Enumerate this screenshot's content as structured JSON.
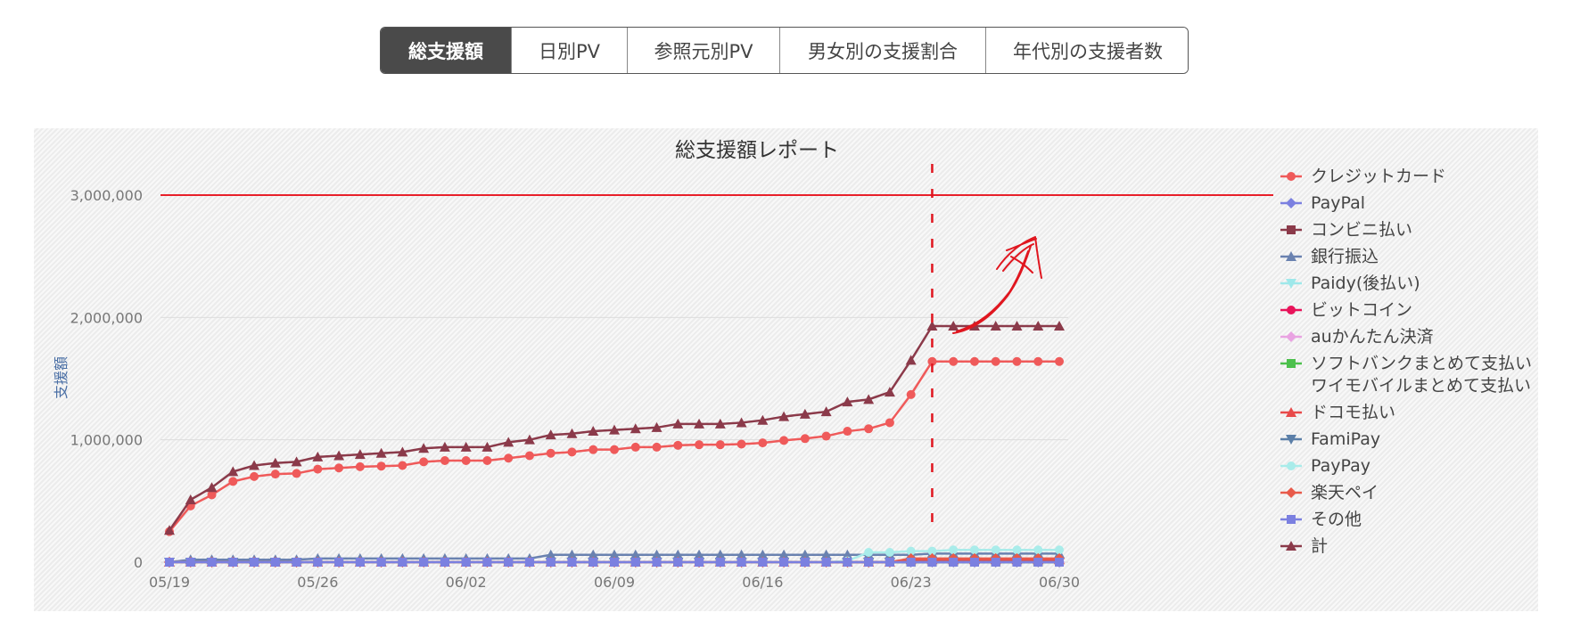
{
  "tabs": [
    {
      "label": "総支援額",
      "active": true
    },
    {
      "label": "日別PV",
      "active": false
    },
    {
      "label": "参照元別PV",
      "active": false
    },
    {
      "label": "男女別の支援割合",
      "active": false
    },
    {
      "label": "年代別の支援者数",
      "active": false
    }
  ],
  "colors": {
    "accent_line": "#e8202a",
    "annotation": "#e0161f",
    "tab_active_bg": "#4a4a4a"
  },
  "chart_data": {
    "type": "line",
    "title": "総支援額レポート",
    "xlabel": "",
    "ylabel": "支援額",
    "ylim": [
      0,
      3000000
    ],
    "y_ticks": [
      0,
      1000000,
      2000000,
      3000000
    ],
    "y_tick_labels": [
      "0",
      "1,000,000",
      "2,000,000",
      "3,000,000"
    ],
    "x_tick_labels": [
      "05/19",
      "05/26",
      "06/02",
      "06/09",
      "06/16",
      "06/23",
      "06/30"
    ],
    "x": [
      "05/19",
      "05/20",
      "05/21",
      "05/22",
      "05/23",
      "05/24",
      "05/25",
      "05/26",
      "05/27",
      "05/28",
      "05/29",
      "05/30",
      "05/31",
      "06/01",
      "06/02",
      "06/03",
      "06/04",
      "06/05",
      "06/06",
      "06/07",
      "06/08",
      "06/09",
      "06/10",
      "06/11",
      "06/12",
      "06/13",
      "06/14",
      "06/15",
      "06/16",
      "06/17",
      "06/18",
      "06/19",
      "06/20",
      "06/21",
      "06/22",
      "06/23",
      "06/24",
      "06/25",
      "06/26",
      "06/27",
      "06/28",
      "06/29",
      "06/30"
    ],
    "goal_line": 3000000,
    "marker_date": "06/24",
    "legend_position": "right",
    "grid": true,
    "series": [
      {
        "name": "クレジットカード",
        "color": "#ef5a5a",
        "marker": "circle",
        "values": [
          250000,
          460000,
          550000,
          660000,
          700000,
          720000,
          725000,
          760000,
          770000,
          780000,
          785000,
          790000,
          820000,
          830000,
          830000,
          830000,
          850000,
          870000,
          890000,
          900000,
          920000,
          920000,
          940000,
          940000,
          955000,
          960000,
          960000,
          965000,
          975000,
          995000,
          1010000,
          1030000,
          1070000,
          1090000,
          1140000,
          1370000,
          1640000,
          1640000,
          1640000,
          1640000,
          1640000,
          1640000,
          1640000
        ]
      },
      {
        "name": "PayPal",
        "color": "#7b80e0",
        "marker": "diamond",
        "values": [
          0,
          0,
          0,
          0,
          0,
          0,
          0,
          0,
          0,
          0,
          0,
          0,
          0,
          0,
          0,
          0,
          0,
          0,
          0,
          0,
          0,
          0,
          0,
          0,
          0,
          0,
          0,
          0,
          0,
          0,
          0,
          0,
          0,
          0,
          0,
          0,
          0,
          0,
          0,
          0,
          0,
          0,
          0
        ]
      },
      {
        "name": "コンビニ払い",
        "color": "#8b3a4a",
        "marker": "square",
        "values": [
          0,
          0,
          0,
          0,
          0,
          0,
          0,
          0,
          0,
          0,
          0,
          0,
          0,
          0,
          0,
          0,
          0,
          0,
          0,
          0,
          0,
          0,
          0,
          0,
          0,
          0,
          0,
          0,
          0,
          0,
          0,
          0,
          0,
          0,
          0,
          0,
          0,
          0,
          0,
          0,
          0,
          0,
          0
        ]
      },
      {
        "name": "銀行振込",
        "color": "#6a82b0",
        "marker": "triangle",
        "values": [
          0,
          20000,
          20000,
          20000,
          20000,
          20000,
          20000,
          30000,
          30000,
          30000,
          30000,
          30000,
          30000,
          30000,
          30000,
          30000,
          30000,
          30000,
          60000,
          60000,
          60000,
          60000,
          60000,
          60000,
          60000,
          60000,
          60000,
          60000,
          60000,
          60000,
          60000,
          60000,
          60000,
          60000,
          60000,
          60000,
          70000,
          70000,
          70000,
          70000,
          70000,
          70000,
          70000
        ]
      },
      {
        "name": "Paidy(後払い)",
        "color": "#9ee8ea",
        "marker": "triangle-down",
        "values": [
          0,
          0,
          0,
          0,
          0,
          0,
          0,
          0,
          0,
          0,
          0,
          0,
          0,
          0,
          0,
          0,
          0,
          0,
          0,
          0,
          0,
          0,
          0,
          0,
          0,
          0,
          0,
          0,
          0,
          0,
          0,
          0,
          0,
          0,
          0,
          0,
          0,
          0,
          0,
          0,
          0,
          0,
          0
        ]
      },
      {
        "name": "ビットコイン",
        "color": "#e8135a",
        "marker": "circle",
        "values": [
          0,
          0,
          0,
          0,
          0,
          0,
          0,
          0,
          0,
          0,
          0,
          0,
          0,
          0,
          0,
          0,
          0,
          0,
          0,
          0,
          0,
          0,
          0,
          0,
          0,
          0,
          0,
          0,
          0,
          0,
          0,
          0,
          0,
          0,
          0,
          0,
          0,
          0,
          0,
          0,
          0,
          0,
          0
        ]
      },
      {
        "name": "auかんたん決済",
        "color": "#e9a3e2",
        "marker": "diamond",
        "values": [
          0,
          0,
          0,
          0,
          0,
          0,
          0,
          0,
          0,
          0,
          0,
          0,
          0,
          0,
          0,
          0,
          0,
          0,
          0,
          0,
          0,
          0,
          0,
          0,
          0,
          0,
          0,
          0,
          0,
          0,
          0,
          0,
          0,
          0,
          0,
          0,
          0,
          0,
          0,
          0,
          0,
          0,
          0
        ]
      },
      {
        "name": "ソフトバンクまとめて支払い・",
        "name2": "ワイモバイルまとめて支払い",
        "color": "#4cc04c",
        "marker": "square",
        "values": [
          0,
          0,
          0,
          0,
          0,
          0,
          0,
          0,
          0,
          0,
          0,
          0,
          0,
          0,
          0,
          0,
          0,
          0,
          0,
          0,
          0,
          0,
          0,
          0,
          0,
          0,
          0,
          0,
          0,
          0,
          0,
          0,
          0,
          0,
          0,
          0,
          0,
          0,
          0,
          0,
          0,
          0,
          0
        ]
      },
      {
        "name": "ドコモ払い",
        "color": "#e84a4a",
        "marker": "triangle",
        "values": [
          0,
          0,
          0,
          0,
          0,
          0,
          0,
          0,
          0,
          0,
          0,
          0,
          0,
          0,
          0,
          0,
          0,
          0,
          0,
          0,
          0,
          0,
          0,
          0,
          0,
          0,
          0,
          0,
          0,
          0,
          0,
          0,
          0,
          0,
          0,
          20000,
          20000,
          20000,
          20000,
          20000,
          20000,
          20000,
          20000
        ]
      },
      {
        "name": "FamiPay",
        "color": "#5b7fa8",
        "marker": "triangle-down",
        "values": [
          0,
          0,
          0,
          0,
          0,
          0,
          0,
          0,
          0,
          0,
          0,
          0,
          0,
          0,
          0,
          0,
          0,
          0,
          0,
          0,
          0,
          0,
          0,
          0,
          0,
          0,
          0,
          0,
          0,
          0,
          0,
          0,
          0,
          0,
          0,
          0,
          0,
          0,
          0,
          0,
          0,
          0,
          0
        ]
      },
      {
        "name": "PayPay",
        "color": "#a9ecea",
        "marker": "circle",
        "values": [
          0,
          0,
          0,
          0,
          0,
          0,
          0,
          0,
          0,
          0,
          0,
          0,
          0,
          0,
          0,
          0,
          0,
          0,
          0,
          0,
          0,
          0,
          0,
          0,
          0,
          0,
          0,
          0,
          0,
          0,
          0,
          0,
          10000,
          80000,
          80000,
          90000,
          90000,
          100000,
          100000,
          100000,
          100000,
          100000,
          100000
        ]
      },
      {
        "name": "楽天ペイ",
        "color": "#e85a4a",
        "marker": "diamond",
        "values": [
          0,
          0,
          0,
          0,
          0,
          0,
          0,
          0,
          0,
          0,
          0,
          0,
          0,
          0,
          0,
          0,
          0,
          0,
          0,
          0,
          0,
          0,
          0,
          0,
          0,
          0,
          0,
          0,
          0,
          0,
          0,
          0,
          0,
          0,
          0,
          30000,
          30000,
          30000,
          30000,
          30000,
          30000,
          30000,
          30000
        ]
      },
      {
        "name": "その他",
        "color": "#7b80e0",
        "marker": "square",
        "values": [
          0,
          0,
          0,
          0,
          0,
          0,
          0,
          0,
          0,
          0,
          0,
          0,
          0,
          0,
          0,
          0,
          0,
          0,
          0,
          0,
          0,
          0,
          0,
          0,
          0,
          0,
          0,
          0,
          0,
          0,
          0,
          0,
          0,
          0,
          0,
          0,
          0,
          0,
          0,
          0,
          0,
          0,
          0
        ]
      },
      {
        "name": "計",
        "color": "#8b3a4a",
        "marker": "triangle",
        "values": [
          260000,
          510000,
          610000,
          740000,
          790000,
          810000,
          820000,
          860000,
          870000,
          880000,
          890000,
          900000,
          930000,
          940000,
          940000,
          940000,
          980000,
          1000000,
          1040000,
          1050000,
          1070000,
          1080000,
          1090000,
          1100000,
          1130000,
          1130000,
          1130000,
          1140000,
          1160000,
          1190000,
          1210000,
          1230000,
          1310000,
          1330000,
          1390000,
          1650000,
          1930000,
          1930000,
          1930000,
          1930000,
          1930000,
          1930000,
          1930000
        ]
      }
    ]
  }
}
